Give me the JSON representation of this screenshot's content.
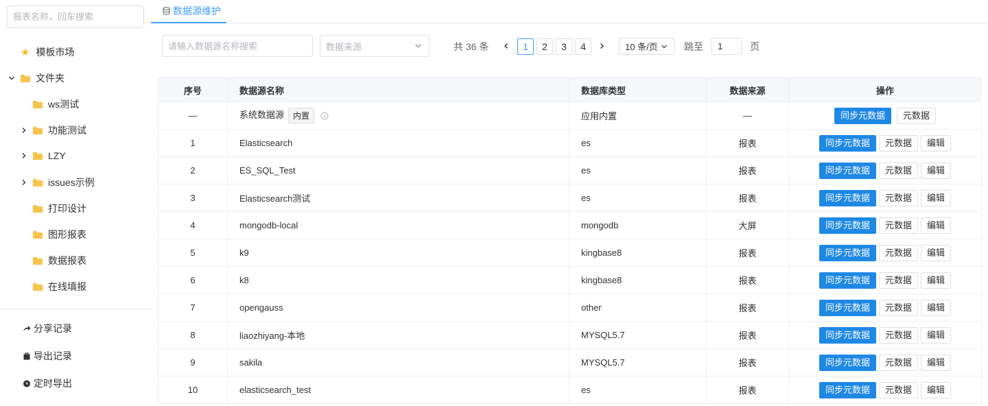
{
  "sidebar": {
    "search_placeholder": "报表名称，回车搜索",
    "market": "模板市场",
    "folder_root": "文件夹",
    "items": [
      "ws测试",
      "功能测试",
      "LZY",
      "issues示例",
      "打印设计",
      "图形报表",
      "数据报表",
      "在线填报"
    ],
    "bottom": [
      "分享记录",
      "导出记录",
      "定时导出"
    ]
  },
  "tab": {
    "label": "数据源维护"
  },
  "filters": {
    "name_placeholder": "请输入数据源名称搜索",
    "source_placeholder": "数据来源"
  },
  "pagination": {
    "total": "共 36 条",
    "pages": [
      "1",
      "2",
      "3",
      "4"
    ],
    "active": "1",
    "size": "10 条/页",
    "jump_label": "跳至",
    "jump_value": "1",
    "page_suffix": "页"
  },
  "table": {
    "headers": [
      "序号",
      "数据源名称",
      "数据库类型",
      "数据来源",
      "操作"
    ],
    "system_row": {
      "index": "—",
      "name": "系统数据源",
      "tag": "内置",
      "type": "应用内置",
      "source": "—"
    },
    "rows": [
      {
        "index": "1",
        "name": "Elasticsearch",
        "type": "es",
        "source": "报表"
      },
      {
        "index": "2",
        "name": "ES_SQL_Test",
        "type": "es",
        "source": "报表"
      },
      {
        "index": "3",
        "name": "Elasticsearch测试",
        "type": "es",
        "source": "报表"
      },
      {
        "index": "4",
        "name": "mongodb-local",
        "type": "mongodb",
        "source": "大屏"
      },
      {
        "index": "5",
        "name": "k9",
        "type": "kingbase8",
        "source": "报表"
      },
      {
        "index": "6",
        "name": "k8",
        "type": "kingbase8",
        "source": "报表"
      },
      {
        "index": "7",
        "name": "opengauss",
        "type": "other",
        "source": "报表"
      },
      {
        "index": "8",
        "name": "liaozhiyang-本地",
        "type": "MYSQL5.7",
        "source": "报表"
      },
      {
        "index": "9",
        "name": "sakila",
        "type": "MYSQL5.7",
        "source": "报表"
      },
      {
        "index": "10",
        "name": "elasticsearch_test",
        "type": "es",
        "source": "报表"
      }
    ],
    "actions": {
      "sync": "同步元数据",
      "meta": "元数据",
      "edit": "编辑"
    }
  },
  "colors": {
    "primary": "#1e88e5",
    "link": "#409eff",
    "folder": "#f7c34a",
    "star": "#f5b821"
  }
}
